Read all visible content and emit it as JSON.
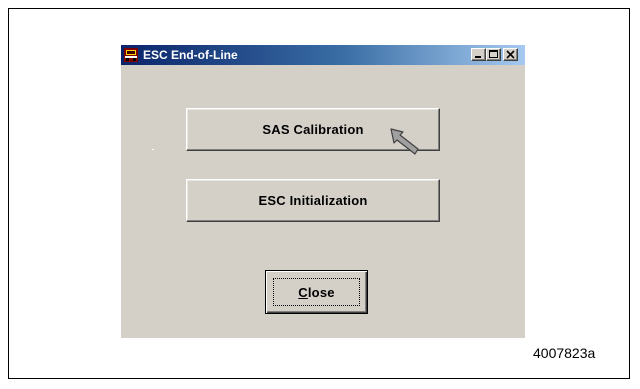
{
  "window": {
    "title": "ESC End-of-Line",
    "icon": "esc-app-icon",
    "controls": {
      "minimize_icon": "minimize-icon",
      "maximize_icon": "maximize-icon",
      "close_icon": "close-icon"
    }
  },
  "buttons": {
    "sas_calibration": "SAS Calibration",
    "esc_initialization": "ESC Initialization",
    "close_first": "C",
    "close_rest": "lose"
  },
  "pointer_icon": "arrow-cursor-icon",
  "figure_id": "4007823a",
  "colors": {
    "window_bg": "#d4d0c8",
    "titlebar_start": "#0a246a",
    "titlebar_end": "#a6caf0"
  }
}
